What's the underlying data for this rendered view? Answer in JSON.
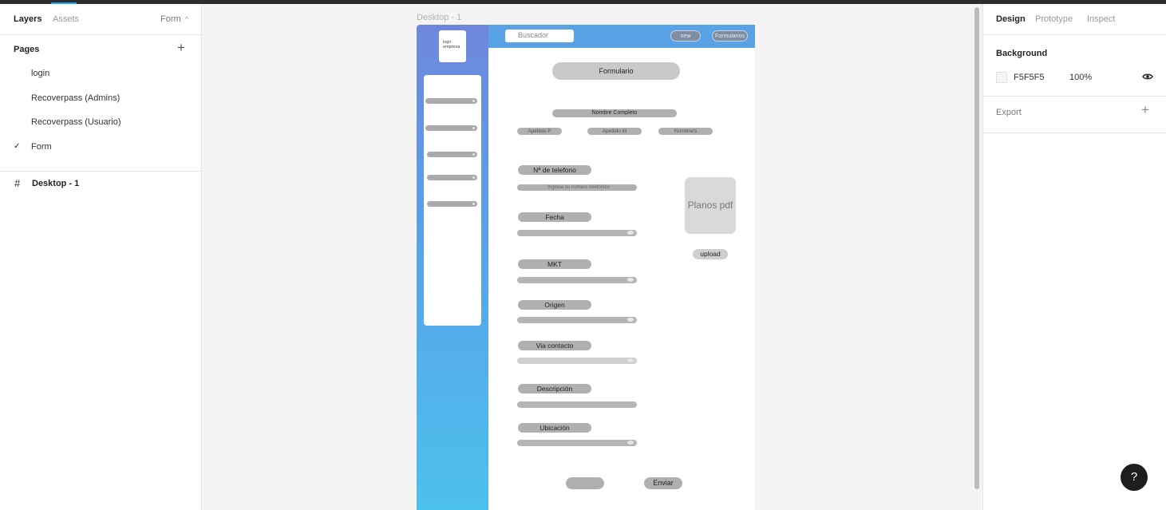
{
  "left_panel": {
    "tabs": {
      "layers": "Layers",
      "assets": "Assets"
    },
    "page_selector": {
      "label": "Form",
      "chevron": "^"
    },
    "pages_title": "Pages",
    "add_icon": "+",
    "pages": [
      {
        "label": "login"
      },
      {
        "label": "Recoverpass (Admins)"
      },
      {
        "label": "Recoverpass (Usuario)"
      },
      {
        "label": "Form",
        "selected": true,
        "check": "✓"
      }
    ],
    "layers": [
      {
        "icon": "frame-hash-icon",
        "glyph": "#",
        "label": "Desktop - 1"
      }
    ]
  },
  "canvas": {
    "frame_label": "Desktop - 1",
    "mockup": {
      "logo_text": "logo empresa",
      "search_placeholder": "Buscador",
      "nav_new": "new",
      "nav_formularios": "Formularios",
      "form_title": "Formulario",
      "nombre_completo": "Nombre Completo",
      "apellido_p": "Apellido P",
      "apellido_m": "Apellido M",
      "nombres": "Nombre/s",
      "telefono_label": "Nª de telefono",
      "telefono_placeholder": "Ingrese su numero telefonico",
      "fecha_label": "Fecha",
      "mkt_label": "MKT",
      "origen_label": "Origen",
      "via_contacto_label": "Via contacto",
      "descripcion_label": "Descripción",
      "ubicacion_label": "Ubicación",
      "planos_label": "Planos pdf",
      "upload_label": "upload",
      "enviar_label": "Enviar"
    }
  },
  "right_panel": {
    "tabs": {
      "design": "Design",
      "prototype": "Prototype",
      "inspect": "Inspect"
    },
    "background": {
      "title": "Background",
      "hex": "F5F5F5",
      "opacity": "100%",
      "color": "#f5f5f5"
    },
    "export": {
      "label": "Export",
      "add_icon": "+"
    },
    "help_icon": "?"
  },
  "colors": {
    "accent": "#18a0fb",
    "sidebar_top": "#6f87dd",
    "sidebar_bottom": "#4cc0ec",
    "navbar": "#5aa2e6"
  }
}
